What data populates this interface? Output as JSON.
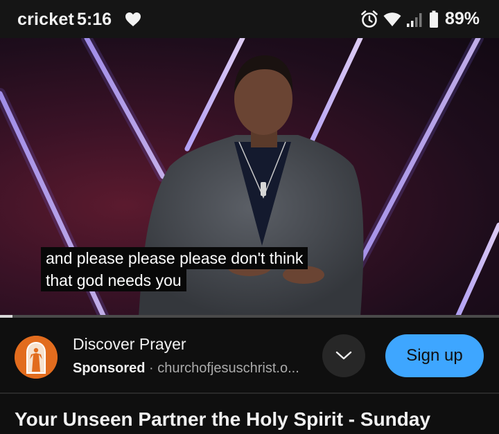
{
  "status_bar": {
    "carrier": "cricket",
    "time": "5:16",
    "battery_percent": "89%",
    "icons": [
      "heart-icon",
      "alarm-icon",
      "wifi-icon",
      "signal-icon",
      "battery-icon"
    ]
  },
  "video": {
    "captions": [
      "and please please please don't think",
      "that god needs you"
    ],
    "progress_fraction": 0.025
  },
  "ad": {
    "title": "Discover Prayer",
    "sponsored_label": "Sponsored",
    "separator": "·",
    "domain": "churchofjesuschrist.o...",
    "signup_label": "Sign up",
    "accent_color": "#3ea6ff",
    "logo_color": "#e26c1e"
  },
  "video_title": "Your Unseen Partner the Holy Spirit - Sunday"
}
